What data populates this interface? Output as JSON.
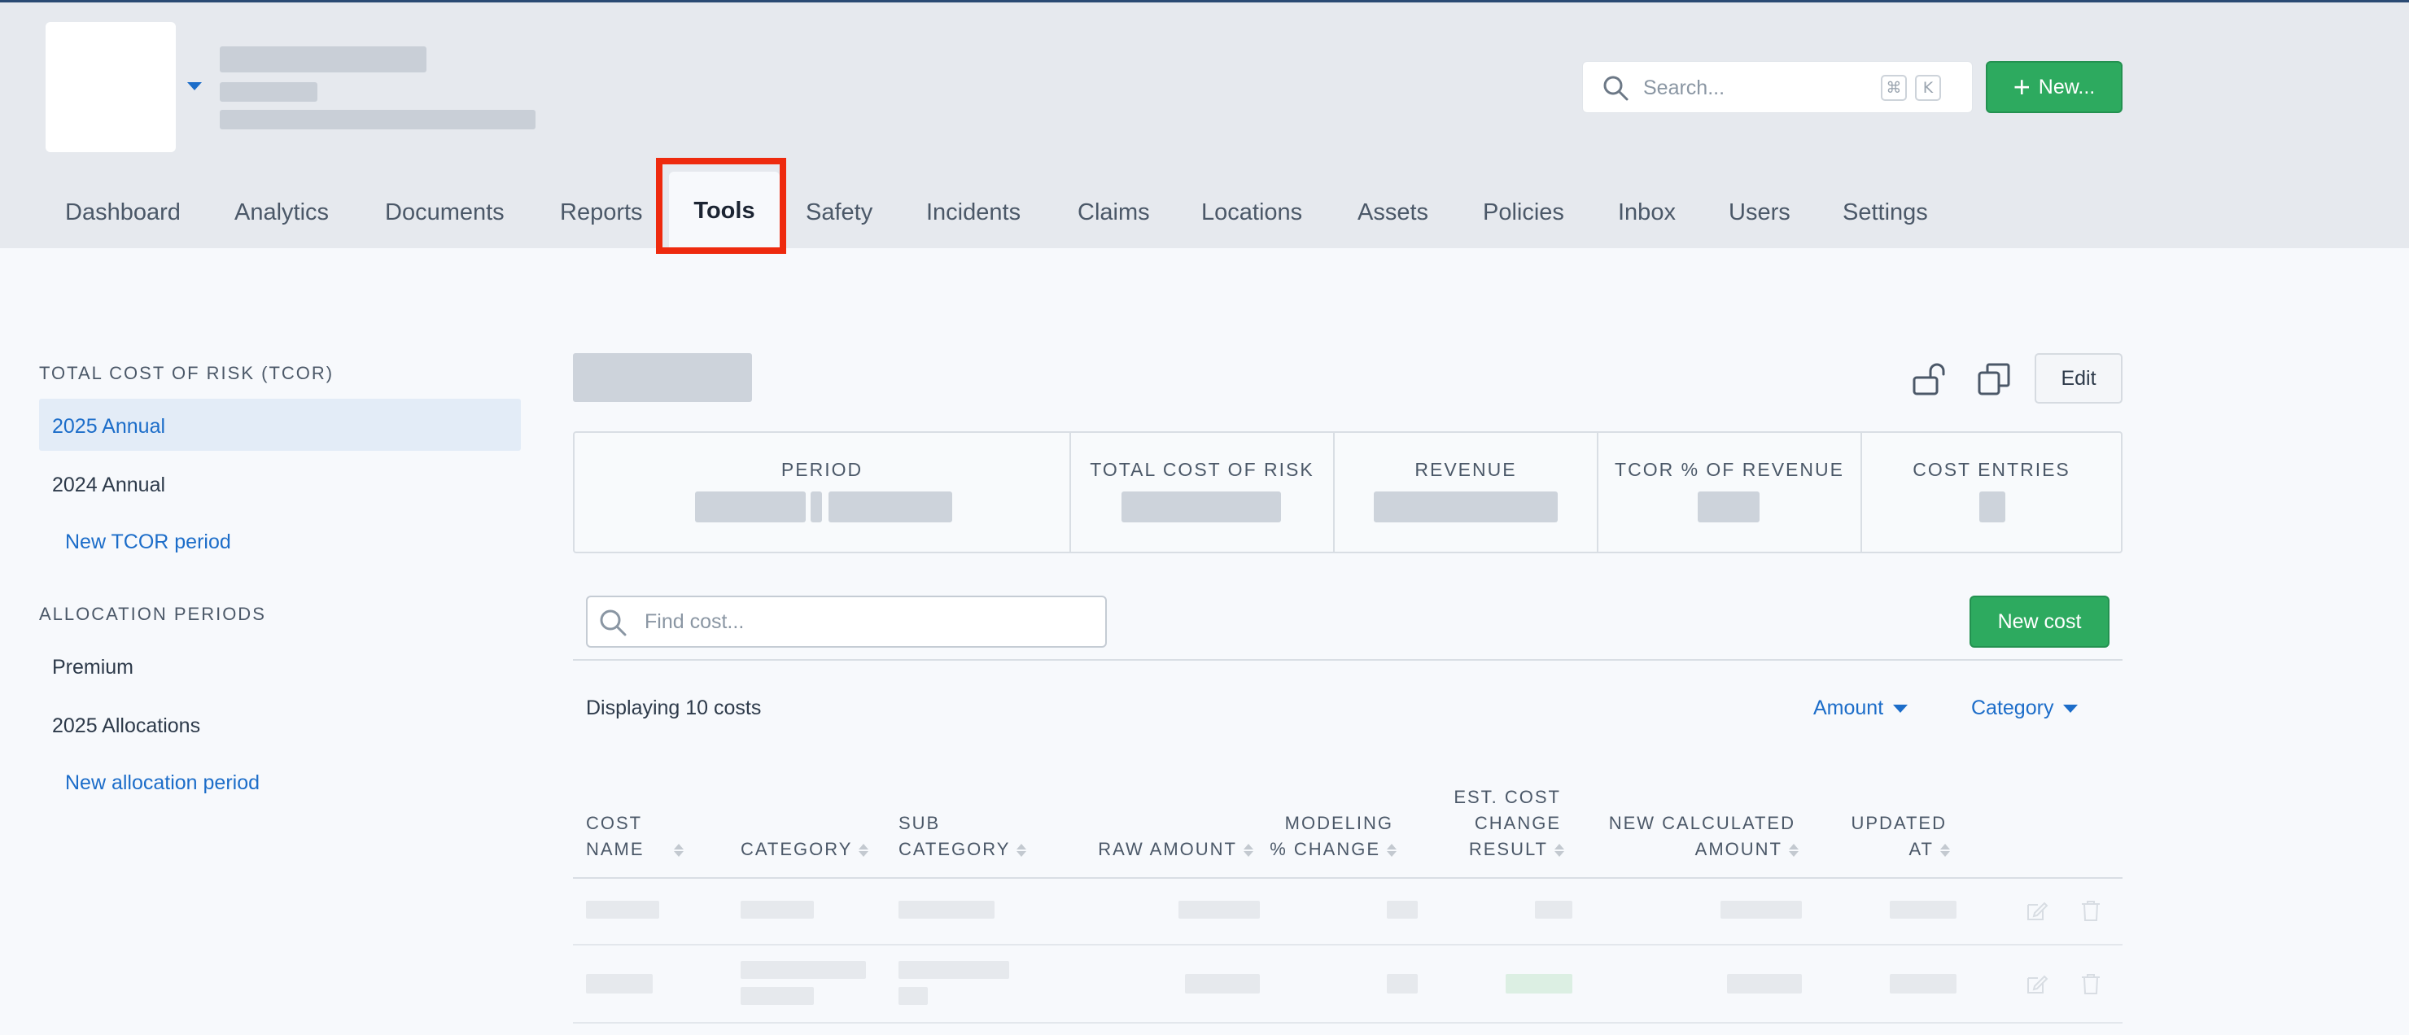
{
  "header": {
    "search": {
      "placeholder": "Search...",
      "kbd_cmd": "⌘",
      "kbd_key": "K"
    },
    "new_button": {
      "label": "New..."
    }
  },
  "nav": {
    "items": [
      {
        "label": "Dashboard"
      },
      {
        "label": "Analytics"
      },
      {
        "label": "Documents"
      },
      {
        "label": "Reports"
      },
      {
        "label": "Tools",
        "active": true
      },
      {
        "label": "Safety"
      },
      {
        "label": "Incidents"
      },
      {
        "label": "Claims"
      },
      {
        "label": "Locations"
      },
      {
        "label": "Assets"
      },
      {
        "label": "Policies"
      },
      {
        "label": "Inbox"
      },
      {
        "label": "Users"
      },
      {
        "label": "Settings"
      }
    ]
  },
  "sidebar": {
    "tcor_heading": "TOTAL COST OF RISK (TCOR)",
    "tcor_items": [
      "2025 Annual",
      "2024 Annual"
    ],
    "tcor_new_link": "New TCOR period",
    "alloc_heading": "ALLOCATION PERIODS",
    "alloc_items": [
      "Premium",
      "2025 Allocations"
    ],
    "alloc_new_link": "New allocation period"
  },
  "main": {
    "edit_label": "Edit",
    "stats": {
      "period": "PERIOD",
      "total": "TOTAL COST OF RISK",
      "revenue": "REVENUE",
      "pct": "TCOR % OF REVENUE",
      "entries": "COST ENTRIES"
    },
    "find_placeholder": "Find cost...",
    "new_cost_label": "New cost",
    "displaying": "Displaying 10 costs",
    "filters": {
      "amount": "Amount",
      "category": "Category"
    },
    "columns": {
      "cost_name": [
        "COST",
        "NAME"
      ],
      "category": [
        "CATEGORY"
      ],
      "sub_category": [
        "SUB",
        "CATEGORY"
      ],
      "raw_amount": [
        "RAW AMOUNT"
      ],
      "modeling": [
        "MODELING",
        "% CHANGE"
      ],
      "est_cost": [
        "EST. COST",
        "CHANGE",
        "RESULT"
      ],
      "new_calc": [
        "NEW CALCULATED",
        "AMOUNT"
      ],
      "updated": [
        "UPDATED",
        "AT"
      ]
    }
  },
  "colors": {
    "accent": "#1c6dc9",
    "primary_button": "#2daa5f",
    "highlight_box": "#ee2a0e"
  }
}
